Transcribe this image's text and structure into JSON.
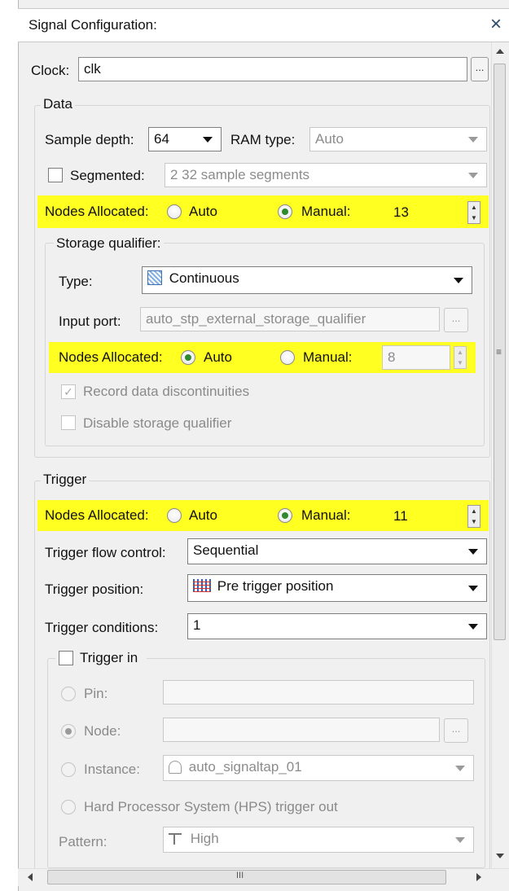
{
  "window": {
    "title": "Signal Configuration:",
    "close_label": "×"
  },
  "clock": {
    "label": "Clock:",
    "value": "clk",
    "browse_label": "..."
  },
  "data": {
    "legend": "Data",
    "sample_depth_label": "Sample depth:",
    "sample_depth_value": "64",
    "ram_type_label": "RAM type:",
    "ram_type_value": "Auto",
    "segmented_label": "Segmented:",
    "segmented_value": "2  32 sample segments",
    "nodes_label": "Nodes Allocated:",
    "auto_label": "Auto",
    "manual_label": "Manual:",
    "nodes_value": "13",
    "storage": {
      "legend": "Storage qualifier:",
      "type_label": "Type:",
      "type_value": "Continuous",
      "input_port_label": "Input port:",
      "input_port_value": "auto_stp_external_storage_qualifier",
      "browse_label": "...",
      "nodes_label": "Nodes Allocated:",
      "auto_label": "Auto",
      "manual_label": "Manual:",
      "nodes_value": "8",
      "record_label": "Record data discontinuities",
      "disable_label": "Disable storage qualifier"
    }
  },
  "trigger": {
    "legend": "Trigger",
    "nodes_label": "Nodes Allocated:",
    "auto_label": "Auto",
    "manual_label": "Manual:",
    "nodes_value": "11",
    "flow_label": "Trigger flow control:",
    "flow_value": "Sequential",
    "position_label": "Trigger position:",
    "position_value": "Pre trigger position",
    "conditions_label": "Trigger conditions:",
    "conditions_value": "1",
    "trigger_in": {
      "legend": "Trigger in",
      "pin_label": "Pin:",
      "node_label": "Node:",
      "browse_label": "...",
      "instance_label": "Instance:",
      "instance_value": "auto_signaltap_01",
      "hps_label": "Hard Processor System (HPS) trigger out",
      "pattern_label": "Pattern:",
      "pattern_value": "High"
    }
  },
  "scrollbars": {
    "h_thumb_grip": "III",
    "v_grip": "≡"
  },
  "colors": {
    "highlight": "#ffff22",
    "radio_checked": "#2f8a2f"
  }
}
